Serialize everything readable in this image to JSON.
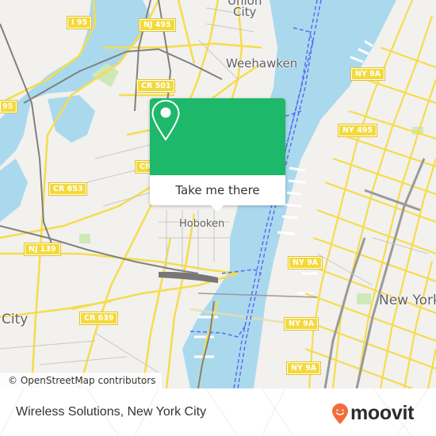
{
  "map": {
    "place_labels": [
      {
        "id": "union-city",
        "text": "Union\nCity"
      },
      {
        "id": "weehawken",
        "text": "Weehawken"
      },
      {
        "id": "hoboken",
        "text": "Hoboken"
      },
      {
        "id": "new-york",
        "text": "New York"
      },
      {
        "id": "jersey-city",
        "text": "City"
      }
    ],
    "road_shields": [
      {
        "id": "i95-top",
        "text": "I 95"
      },
      {
        "id": "nj495",
        "text": "NJ 495"
      },
      {
        "id": "cr501",
        "text": "CR 501"
      },
      {
        "id": "i95-left",
        "text": "95"
      },
      {
        "id": "cr-partial",
        "text": "CR"
      },
      {
        "id": "cr653",
        "text": "CR 653"
      },
      {
        "id": "ny495",
        "text": "NY 495"
      },
      {
        "id": "nj139",
        "text": "NJ 139"
      },
      {
        "id": "ny9a-1",
        "text": "NY 9A"
      },
      {
        "id": "ny9a-2",
        "text": "NY 9A"
      },
      {
        "id": "ny9a-3",
        "text": "NY 9A"
      },
      {
        "id": "cr639",
        "text": "CR 639"
      }
    ],
    "colors": {
      "water": "#aad9ee",
      "land": "#f2f1ee",
      "road": "#f6dc4d",
      "rail": "#8a8a8a",
      "ferry": "#5b6bf0",
      "park": "#cfe8b8"
    }
  },
  "popup": {
    "button_label": "Take me there",
    "icon": "map-pin-icon",
    "accent": "#1db869"
  },
  "attribution": "© OpenStreetMap contributors",
  "footer": {
    "title": "Wireless Solutions, New York City",
    "brand": "moovit",
    "brand_icon": "moovit-pin-smile-icon",
    "brand_color": "#f26b3a"
  }
}
